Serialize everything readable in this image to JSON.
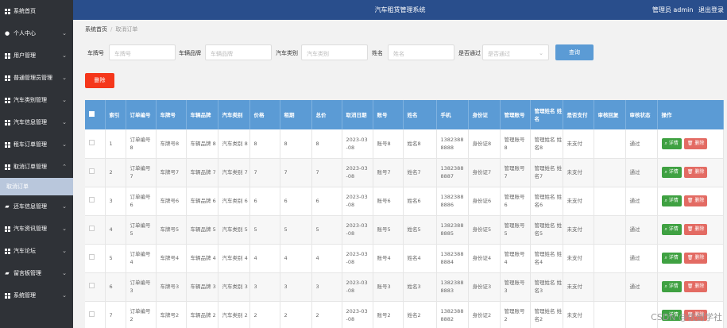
{
  "header": {
    "title": "汽车租赁管理系统",
    "role": "管理员 admin",
    "logout": "退出登录"
  },
  "sidebar": {
    "items": [
      {
        "label": "系统首页",
        "icon": "grid"
      },
      {
        "label": "个人中心",
        "icon": "user"
      },
      {
        "label": "用户管理",
        "icon": "grid"
      },
      {
        "label": "普通管理员管理",
        "icon": "grid"
      },
      {
        "label": "汽车类别管理",
        "icon": "grid"
      },
      {
        "label": "汽车信息管理",
        "icon": "grid"
      },
      {
        "label": "租车订单管理",
        "icon": "grid"
      },
      {
        "label": "取消订单管理",
        "icon": "grid"
      },
      {
        "label": "还车信息管理",
        "icon": "thumb"
      },
      {
        "label": "汽车资讯管理",
        "icon": "grid"
      },
      {
        "label": "汽车论坛",
        "icon": "grid"
      },
      {
        "label": "留言板管理",
        "icon": "thumb"
      },
      {
        "label": "系统管理",
        "icon": "grid"
      }
    ],
    "sub_item": "取消订单"
  },
  "breadcrumb": {
    "home": "系统首页",
    "current": "取消订单"
  },
  "search": {
    "plate_label": "车牌号",
    "plate_placeholder": "车牌号",
    "brand_label": "车辆品牌",
    "brand_placeholder": "车辆品牌",
    "type_label": "汽车类别",
    "type_placeholder": "汽车类别",
    "name_label": "姓名",
    "name_placeholder": "姓名",
    "approved_label": "是否通过",
    "approved_placeholder": "是否通过",
    "button": "查询"
  },
  "delete_button": "删除",
  "table": {
    "headers": [
      "",
      "索引",
      "订单编号",
      "车牌号",
      "车辆品牌",
      "汽车类别",
      "价格",
      "租期",
      "总价",
      "取消日期",
      "账号",
      "姓名",
      "手机",
      "身份证",
      "管理账号",
      "管理姓名 姓名",
      "是否支付",
      "审核回复",
      "审核状态",
      "操作"
    ],
    "detail_label": "详情",
    "delete_label": "删除",
    "rows": [
      {
        "idx": "1",
        "order": "订单编号 8",
        "plate": "车牌号8",
        "brand": "车辆品牌 8",
        "type": "汽车类别 8",
        "price": "8",
        "term": "8",
        "total": "8",
        "date": "2023-03 -08",
        "account": "账号8",
        "name": "姓名8",
        "phone": "1382388 8888",
        "id": "身份证8",
        "mgr_acc": "管理账号 8",
        "mgr_name": "管理姓名 姓名8",
        "paid": "未支付",
        "reply": "",
        "status": "通过"
      },
      {
        "idx": "2",
        "order": "订单编号 7",
        "plate": "车牌号7",
        "brand": "车辆品牌 7",
        "type": "汽车类别 7",
        "price": "7",
        "term": "7",
        "total": "7",
        "date": "2023-03 -08",
        "account": "账号7",
        "name": "姓名7",
        "phone": "1382388 8887",
        "id": "身份证7",
        "mgr_acc": "管理账号 7",
        "mgr_name": "管理姓名 姓名7",
        "paid": "未支付",
        "reply": "",
        "status": "通过"
      },
      {
        "idx": "3",
        "order": "订单编号 6",
        "plate": "车牌号6",
        "brand": "车辆品牌 6",
        "type": "汽车类别 6",
        "price": "6",
        "term": "6",
        "total": "6",
        "date": "2023-03 -08",
        "account": "账号6",
        "name": "姓名6",
        "phone": "1382388 8886",
        "id": "身份证6",
        "mgr_acc": "管理账号 6",
        "mgr_name": "管理姓名 姓名6",
        "paid": "未支付",
        "reply": "",
        "status": "通过"
      },
      {
        "idx": "4",
        "order": "订单编号 5",
        "plate": "车牌号5",
        "brand": "车辆品牌 5",
        "type": "汽车类别 5",
        "price": "5",
        "term": "5",
        "total": "5",
        "date": "2023-03 -08",
        "account": "账号5",
        "name": "姓名5",
        "phone": "1382388 8885",
        "id": "身份证5",
        "mgr_acc": "管理账号 5",
        "mgr_name": "管理姓名 姓名5",
        "paid": "未支付",
        "reply": "",
        "status": "通过"
      },
      {
        "idx": "5",
        "order": "订单编号 4",
        "plate": "车牌号4",
        "brand": "车辆品牌 4",
        "type": "汽车类别 4",
        "price": "4",
        "term": "4",
        "total": "4",
        "date": "2023-03 -08",
        "account": "账号4",
        "name": "姓名4",
        "phone": "1382388 8884",
        "id": "身份证4",
        "mgr_acc": "管理账号 4",
        "mgr_name": "管理姓名 姓名4",
        "paid": "未支付",
        "reply": "",
        "status": "通过"
      },
      {
        "idx": "6",
        "order": "订单编号 3",
        "plate": "车牌号3",
        "brand": "车辆品牌 3",
        "type": "汽车类别 3",
        "price": "3",
        "term": "3",
        "total": "3",
        "date": "2023-03 -08",
        "account": "账号3",
        "name": "姓名3",
        "phone": "1382388 8883",
        "id": "身份证3",
        "mgr_acc": "管理账号 3",
        "mgr_name": "管理姓名 姓名3",
        "paid": "未支付",
        "reply": "",
        "status": "通过"
      },
      {
        "idx": "7",
        "order": "订单编号 2",
        "plate": "车牌号2",
        "brand": "车辆品牌 2",
        "type": "汽车类别 2",
        "price": "2",
        "term": "2",
        "total": "2",
        "date": "2023-03 -08",
        "account": "账号2",
        "name": "姓名2",
        "phone": "1382388 8882",
        "id": "身份证2",
        "mgr_acc": "管理账号 2",
        "mgr_name": "管理姓名 姓名2",
        "paid": "未支付",
        "reply": "",
        "status": ""
      }
    ]
  },
  "watermark": "CSDN @优创学社"
}
